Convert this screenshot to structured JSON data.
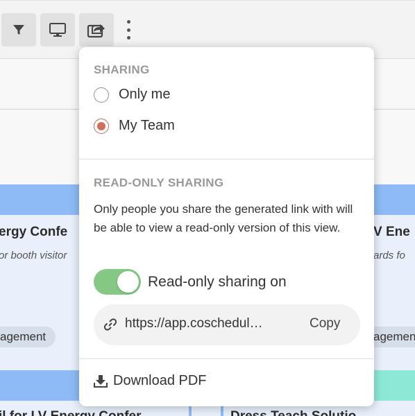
{
  "toolbar": {
    "filter_icon": "filter-icon",
    "monitor_icon": "monitor-icon",
    "share_icon": "share-icon",
    "more_icon": "more-vertical-icon"
  },
  "background": {
    "card_left_title": "ergy Confe",
    "card_left_sub": "or booth visitor",
    "card_left_tag": "agement",
    "card_right_title": "V Ene",
    "card_right_sub": "ards fo",
    "card_right_tag": "agement",
    "card2_left_title": "il for LV Energy Confer",
    "card2_right_title": "Dress Teach Solutio"
  },
  "popup": {
    "sharing_title": "SHARING",
    "options": [
      {
        "label": "Only me",
        "checked": false
      },
      {
        "label": "My Team",
        "checked": true
      }
    ],
    "readonly_title": "READ-ONLY SHARING",
    "description": "Only people you share the generated link with will be able to view a read-only version of this view.",
    "toggle_label": "Read-only sharing on",
    "toggle_on": true,
    "link_text": "https://app.coschedul…",
    "copy_label": "Copy",
    "download_label": "Download PDF"
  },
  "colors": {
    "accent_radio": "#d0705c",
    "toggle_on": "#84c884",
    "card_blue": "#8ebbf6",
    "card_teal": "#8de9d6"
  }
}
